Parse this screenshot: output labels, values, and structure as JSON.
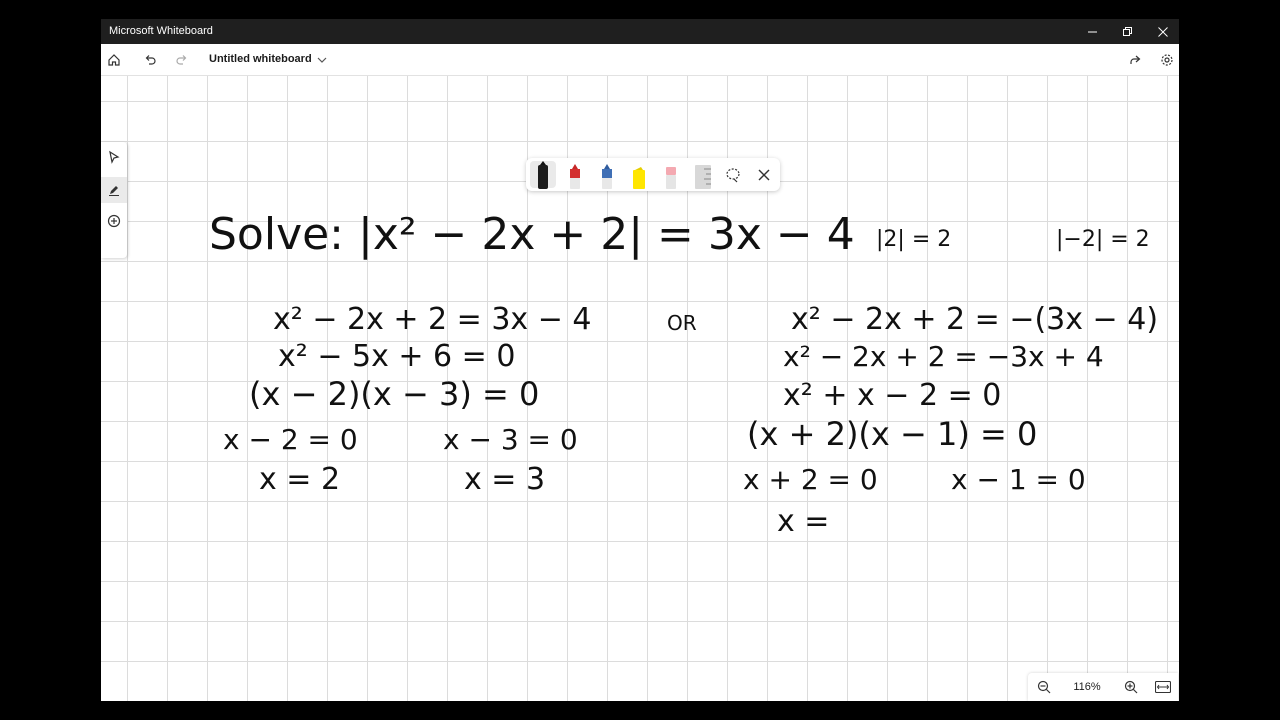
{
  "app": {
    "window_title": "Microsoft Whiteboard",
    "document_title": "Untitled whiteboard"
  },
  "zoom": {
    "level": "116%"
  },
  "ink": {
    "problem": "Solve:  |x² − 2x + 2| = 3x − 4",
    "example1": "|2| = 2",
    "example2": "|−2| = 2",
    "or": "OR",
    "left": [
      "x² − 2x + 2 = 3x − 4",
      "x² − 5x + 6 = 0",
      "(x − 2)(x − 3) = 0",
      "x − 2 = 0",
      "x − 3 = 0",
      "x = 2",
      "x = 3"
    ],
    "right": [
      "x² − 2x + 2 = −(3x − 4)",
      "x² − 2x + 2 = −3x + 4",
      "x² + x − 2 = 0",
      "(x + 2)(x − 1) = 0",
      "x + 2 = 0",
      "x − 1 = 0",
      "x ="
    ]
  },
  "colors": {
    "titlebar": "#1f1f1f",
    "grid": "#dcdcdc",
    "ink": "#111111",
    "accent_red": "#d32f2f",
    "accent_blue": "#3f6fb5",
    "accent_yellow": "#ffe600"
  }
}
